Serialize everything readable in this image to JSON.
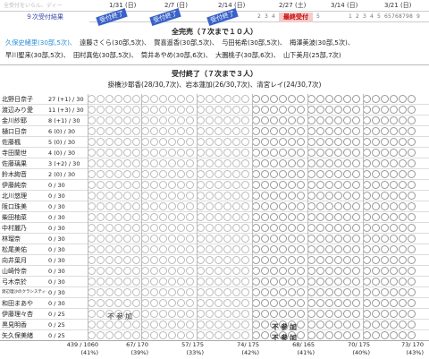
{
  "header": {
    "hint": "全受付をいらん、ディー",
    "summary_label": "９次受付結果",
    "dates": [
      "1/31 (日)",
      "2/7 (日)",
      "2/14 (日)",
      "2/27 (土)",
      "3/14 (日)",
      "3/21 (日)"
    ],
    "stamp": "受付終了",
    "final_label": "最終受付",
    "mini": [
      "2",
      "3",
      "4",
      "5",
      "1",
      "2",
      "3",
      "4",
      "5",
      "6",
      "7",
      "8",
      "9",
      "5",
      "6",
      "7",
      "8",
      "9"
    ]
  },
  "sections": {
    "complete_title": "全完売（７次まで１０人）",
    "complete_line1": [
      "久保史緒里(30部,5次)、",
      "遠藤さくら(30部,5次)、",
      "賀喜遥香(30部,5次)、",
      "与田祐希(30部,5次)、",
      "梅澤美波(30部,5次)、"
    ],
    "complete_line2": [
      "早川聖来(30部,5次)、",
      "田村真佑(30部,5次)、",
      "筒井あやめ(30部,6次)、",
      "大園桃子(30部,6次)、",
      "山下美月(25部,7次)"
    ],
    "closed_title": "受付終了（７次まで３人）",
    "closed_line": "掛橋沙耶香(28/30,7次)、岩本蓮加(26/30,7次)、清宮レイ(24/30,7次)"
  },
  "members": [
    {
      "name": "北野日奈子",
      "count": "27 (+1) / 30"
    },
    {
      "name": "渡辺みり愛",
      "count": "11 (+3) / 30"
    },
    {
      "name": "金川紗耶",
      "count": "8 (+1) / 30"
    },
    {
      "name": "樋口日奈",
      "count": "6 (0) / 30"
    },
    {
      "name": "佐藤楓",
      "count": "5 (0) / 30"
    },
    {
      "name": "寺田蘭世",
      "count": "4 (0) / 30"
    },
    {
      "name": "佐藤璃果",
      "count": "3 (+2) / 30"
    },
    {
      "name": "鈴木絢音",
      "count": "2 (0) / 30"
    },
    {
      "name": "伊藤純奈",
      "count": "0 / 30"
    },
    {
      "name": "北川悠理",
      "count": "0 / 30"
    },
    {
      "name": "阪口珠美",
      "count": "0 / 30"
    },
    {
      "name": "柴田柚菜",
      "count": "0 / 30"
    },
    {
      "name": "中村麗乃",
      "count": "0 / 30"
    },
    {
      "name": "林瑠奈",
      "count": "0 / 30"
    },
    {
      "name": "松尾美佑",
      "count": "0 / 30"
    },
    {
      "name": "向井葉月",
      "count": "0 / 30"
    },
    {
      "name": "山崎怜奈",
      "count": "0 / 30"
    },
    {
      "name": "弓木奈於",
      "count": "0 / 30"
    },
    {
      "name": "渡辺理沙のクラシスティー",
      "count": "0 / 30"
    },
    {
      "name": "和田まあや",
      "count": "0 / 30"
    },
    {
      "name": "伊藤理々杏",
      "count": "0 / 25"
    },
    {
      "name": "黒見明香",
      "count": "0 / 25"
    },
    {
      "name": "矢久保美緒",
      "count": "0 / 25"
    }
  ],
  "notes": {
    "not_joining": "不参加"
  },
  "footer": {
    "total": "439 / 1060",
    "total_pct": "(41%)",
    "cols": [
      {
        "v": "67/ 170",
        "p": "(39%)"
      },
      {
        "v": "57/ 175",
        "p": "(33%)"
      },
      {
        "v": "74/ 175",
        "p": "(42%)"
      },
      {
        "v": "68/ 165",
        "p": "(41%)"
      },
      {
        "v": "70/ 175",
        "p": "(40%)"
      },
      {
        "v": "73/ 170",
        "p": "(43%)"
      }
    ]
  },
  "colors": {
    "accent": "#3a62c8",
    "yellow": "#ffe45c",
    "shade": "#dde6f6"
  }
}
